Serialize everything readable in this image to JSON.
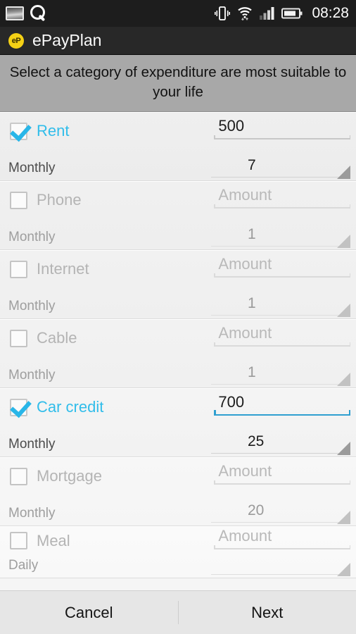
{
  "statusbar": {
    "icons_left": [
      "image-notification-icon",
      "search-icon"
    ],
    "icons_right": [
      "vibrate-icon",
      "wifi-icon",
      "signal-icon",
      "battery-icon"
    ],
    "clock": "08:28"
  },
  "actionbar": {
    "app_badge": "eP",
    "title": "ePayPlan"
  },
  "banner": {
    "text": "Select a category of expenditure are most suitable to your life"
  },
  "colors": {
    "accent": "#31bdea",
    "focus_underline": "#2f9fd0",
    "badge": "#f5d115",
    "banner_bg": "#a8a8a8",
    "statusbar_bg": "#1d1d1d",
    "actionbar_bg": "#282828"
  },
  "amount_placeholder": "Amount",
  "rows": [
    {
      "label": "Rent",
      "checked": true,
      "amount": "500",
      "amount_is_placeholder": false,
      "amount_focused": false,
      "period": "Monthly",
      "count": "7"
    },
    {
      "label": "Phone",
      "checked": false,
      "amount": "Amount",
      "amount_is_placeholder": true,
      "amount_focused": false,
      "period": "Monthly",
      "count": "1"
    },
    {
      "label": "Internet",
      "checked": false,
      "amount": "Amount",
      "amount_is_placeholder": true,
      "amount_focused": false,
      "period": "Monthly",
      "count": "1"
    },
    {
      "label": "Cable",
      "checked": false,
      "amount": "Amount",
      "amount_is_placeholder": true,
      "amount_focused": false,
      "period": "Monthly",
      "count": "1"
    },
    {
      "label": "Car credit",
      "checked": true,
      "amount": "700",
      "amount_is_placeholder": false,
      "amount_focused": true,
      "period": "Monthly",
      "count": "25"
    },
    {
      "label": "Mortgage",
      "checked": false,
      "amount": "Amount",
      "amount_is_placeholder": true,
      "amount_focused": false,
      "period": "Monthly",
      "count": "20"
    },
    {
      "label": "Meal",
      "checked": false,
      "amount": "Amount",
      "amount_is_placeholder": true,
      "amount_focused": false,
      "period": "Daily",
      "count": ""
    }
  ],
  "footer": {
    "cancel_label": "Cancel",
    "next_label": "Next"
  }
}
